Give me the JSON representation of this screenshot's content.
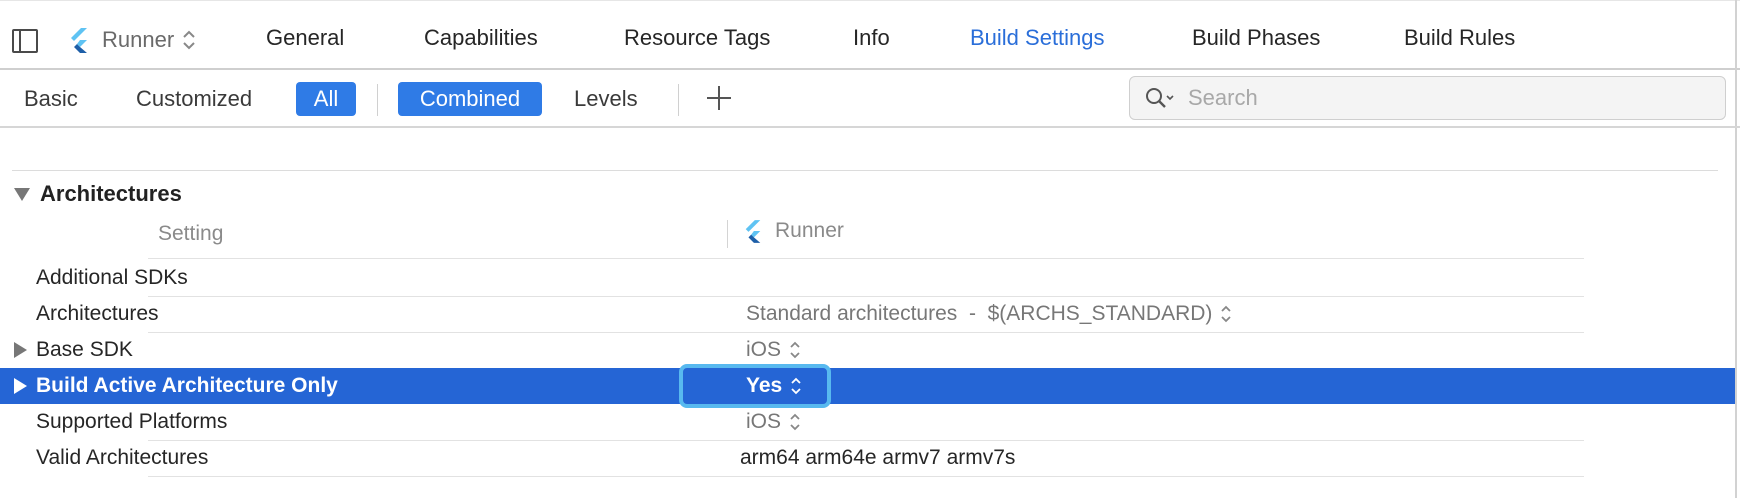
{
  "window": {
    "target": {
      "name": "Runner",
      "icon": "flutter-icon"
    },
    "tabs": [
      {
        "label": "General",
        "active": false
      },
      {
        "label": "Capabilities",
        "active": false
      },
      {
        "label": "Resource Tags",
        "active": false
      },
      {
        "label": "Info",
        "active": false
      },
      {
        "label": "Build Settings",
        "active": true
      },
      {
        "label": "Build Phases",
        "active": false
      },
      {
        "label": "Build Rules",
        "active": false
      }
    ]
  },
  "filterbar": {
    "scope": [
      {
        "label": "Basic",
        "selected": false
      },
      {
        "label": "Customized",
        "selected": false
      },
      {
        "label": "All",
        "selected": true
      }
    ],
    "view": [
      {
        "label": "Combined",
        "selected": true
      },
      {
        "label": "Levels",
        "selected": false
      }
    ],
    "add_icon": "plus-icon",
    "search": {
      "placeholder": "Search",
      "value": "",
      "icon": "search-icon"
    }
  },
  "section": {
    "title": "Architectures",
    "expanded": true,
    "columns": {
      "setting": "Setting",
      "target": "Runner"
    },
    "rows": [
      {
        "name": "Additional SDKs",
        "value": "",
        "expandable": false,
        "selected": false,
        "popup": false
      },
      {
        "name": "Architectures",
        "value": "Standard architectures  -  $(ARCHS_STANDARD)",
        "expandable": false,
        "selected": false,
        "popup": true
      },
      {
        "name": "Base SDK",
        "value": "iOS",
        "expandable": true,
        "selected": false,
        "popup": true
      },
      {
        "name": "Build Active Architecture Only",
        "value": "Yes",
        "expandable": true,
        "selected": true,
        "popup": true
      },
      {
        "name": "Supported Platforms",
        "value": "iOS",
        "expandable": false,
        "selected": false,
        "popup": true
      },
      {
        "name": "Valid Architectures",
        "value": "arm64 arm64e armv7 armv7s",
        "expandable": false,
        "selected": false,
        "popup": false
      }
    ]
  },
  "colors": {
    "accent": "#2f7be6",
    "active_tab_text": "#2a6ed9",
    "selection": "#2565d5",
    "focus_ring": "#58b9ef"
  }
}
